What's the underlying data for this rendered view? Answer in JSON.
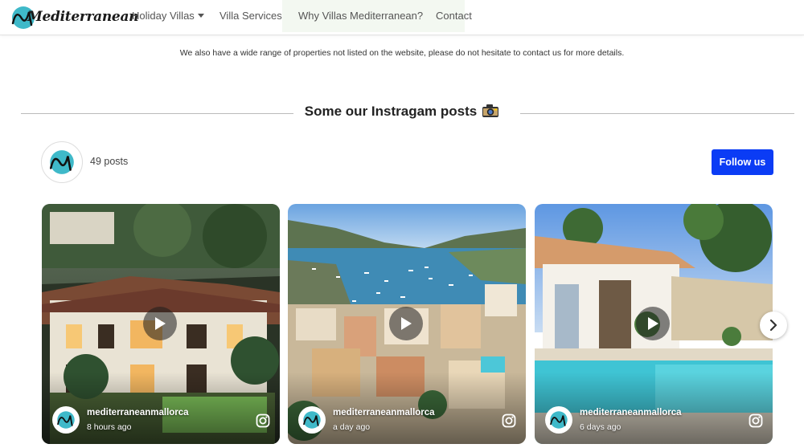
{
  "nav": {
    "logo_text": "Mediterranean",
    "items": [
      {
        "label": "Holiday Villas"
      },
      {
        "label": "Villa Services"
      },
      {
        "label": "Why Villas Mediterranean?"
      },
      {
        "label": "Contact"
      }
    ]
  },
  "notice": "We also have a wide range of properties not listed on the website, please do not hesitate to contact us for more details.",
  "section": {
    "title": "Some our Instragam posts",
    "icon": "camera-icon"
  },
  "instagram": {
    "posts_count": "49 posts",
    "follow_label": "Follow us",
    "cards": [
      {
        "username": "mediterraneanmallorca",
        "time": "8 hours ago"
      },
      {
        "username": "mediterraneanmallorca",
        "time": "a day ago"
      },
      {
        "username": "mediterraneanmallorca",
        "time": "6 days ago"
      }
    ]
  },
  "colors": {
    "accent": "#0b3cf5",
    "logo_teal": "#3fb9c9"
  }
}
